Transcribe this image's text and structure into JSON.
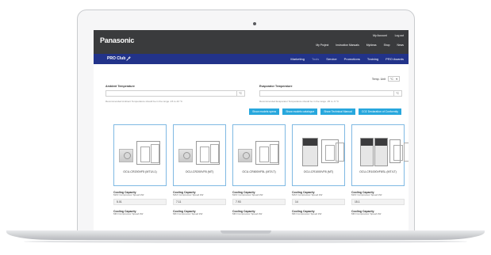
{
  "header": {
    "logo": "Panasonic",
    "util_top": [
      "My Account",
      "Log out"
    ],
    "util_bottom": [
      "My Project",
      "Instruction Manuals",
      "MyIdeas",
      "Shop",
      "News"
    ]
  },
  "nav": {
    "brand": "PRO Club",
    "links": [
      {
        "label": "Marketing",
        "dim": false
      },
      {
        "label": "Tools",
        "dim": true
      },
      {
        "label": "Service",
        "dim": false
      },
      {
        "label": "Promotions",
        "dim": false
      },
      {
        "label": "Training",
        "dim": false
      },
      {
        "label": "PRO Awards",
        "dim": false
      }
    ]
  },
  "filters": {
    "temp_unit_label": "Temp. Unit",
    "temp_unit_value": "°C",
    "ambient_label": "Ambient Temperature",
    "ambient_unit": "°C",
    "ambient_hint": "Recommended Ambient Temperature should be in the range -15 to 43 °C",
    "evaporator_label": "Evaporator Temperature",
    "evaporator_unit": "°C",
    "evaporator_hint": "Recommended Evaporator Temperature should be in the range -45 to -5 °C"
  },
  "actions": [
    "Show models specs",
    "Show models catalogue",
    "Show Technical Manual",
    "CO2 Declaration of Conformity"
  ],
  "products": [
    {
      "name": "OCU-CR200VF5 (MT1/L1)",
      "style": "flat",
      "cap1": "5.01"
    },
    {
      "name": "OCU-CR200VF8 (MT)",
      "style": "flat",
      "cap1": "7.11"
    },
    {
      "name": "OCU-CR800VF5L (MT/LT)",
      "style": "flat",
      "cap1": "7.93"
    },
    {
      "name": "OCU-CR1000VF8 (MT)",
      "style": "tall",
      "cap1": "14"
    },
    {
      "name": "OCU-CR1000VF8SL (MT/LT)",
      "style": "double",
      "cap1": "15.1"
    }
  ],
  "spec": {
    "label": "Cooling Capacity",
    "sub1": "MAX Compressor Speed kW",
    "sub2": "MIN Compressor Speed kW"
  }
}
